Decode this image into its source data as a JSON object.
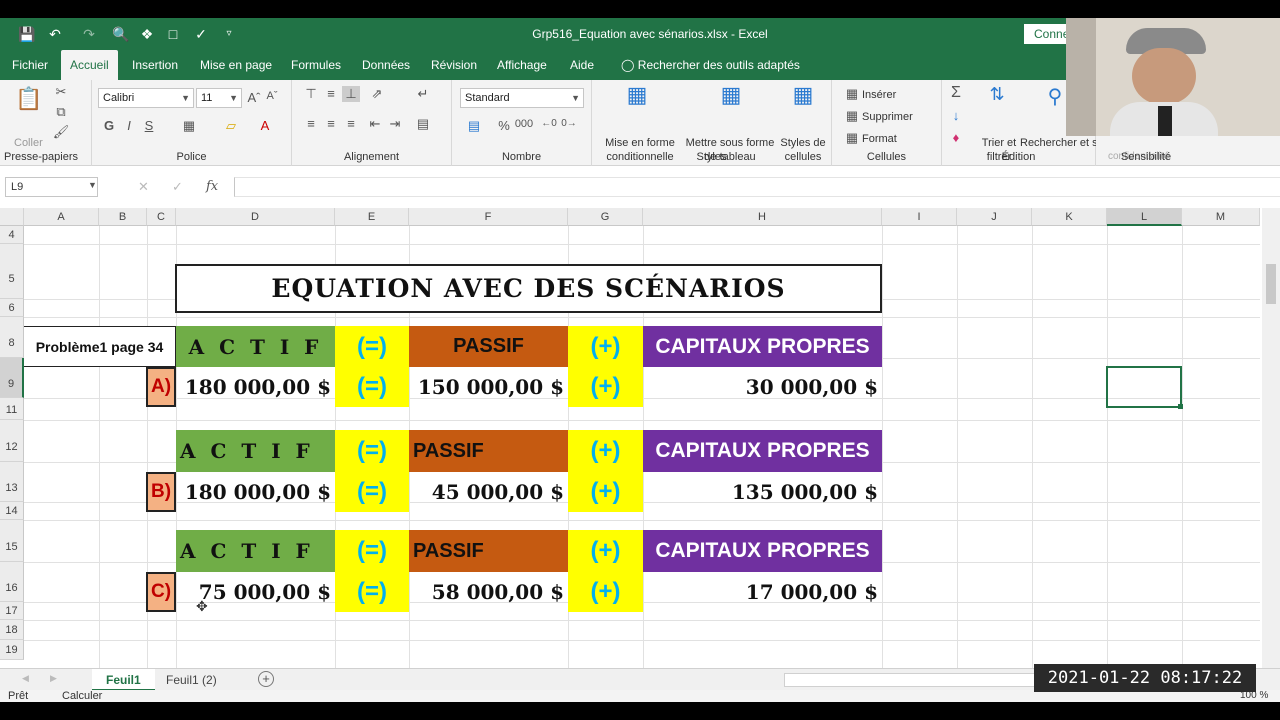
{
  "window": {
    "title": "Grp516_Equation avec sénarios.xlsx  -  Excel",
    "connect": "Conne"
  },
  "tabs": [
    "Fichier",
    "Accueil",
    "Insertion",
    "Mise en page",
    "Formules",
    "Données",
    "Révision",
    "Affichage",
    "Aide",
    "Rechercher des outils adaptés"
  ],
  "ribbon": {
    "clipboard": {
      "paste": "Coller",
      "label": "Presse-papiers"
    },
    "font": {
      "name": "Calibri",
      "size": "11",
      "label": "Police",
      "bold": "G",
      "italic": "I",
      "underline": "S"
    },
    "alignment": {
      "label": "Alignement"
    },
    "number": {
      "format": "Standard",
      "label": "Nombre"
    },
    "styles": {
      "conditional": "Mise en forme conditionnelle",
      "table": "Mettre sous forme de tableau",
      "cell": "Styles de cellules",
      "label": "Styles"
    },
    "cells": {
      "insert": "Insérer",
      "delete": "Supprimer",
      "format": "Format",
      "label": "Cellules"
    },
    "editing": {
      "sort": "Trier et filtrer",
      "find": "Rechercher et sélectionner",
      "label": "Édition"
    },
    "sensitivity": {
      "label": "Sensibilité",
      "text": "confidentialité"
    }
  },
  "formula_bar": {
    "name_box": "L9",
    "fx": "fx",
    "content": ""
  },
  "columns": [
    "A",
    "B",
    "C",
    "D",
    "E",
    "F",
    "G",
    "H",
    "I",
    "J",
    "K",
    "L",
    "M"
  ],
  "rows": [
    "4",
    "5",
    "6",
    "8",
    "9",
    "11",
    "12",
    "13",
    "14",
    "15",
    "16",
    "17",
    "18",
    "19"
  ],
  "sheet": {
    "title": "EQUATION AVEC DES SCÉNARIOS",
    "problem": "Problème1 page 34",
    "actif": "A C T I F",
    "passif": "PASSIF",
    "capitaux": "CAPITAUX PROPRES",
    "eq": "(=)",
    "plus": "(+)",
    "scenarios": [
      {
        "label": "A)",
        "actif": "180 000,00 $",
        "passif": "150 000,00 $",
        "capitaux": "30 000,00 $"
      },
      {
        "label": "B)",
        "actif": "180 000,00 $",
        "passif": "45 000,00 $",
        "capitaux": "135 000,00 $"
      },
      {
        "label": "C)",
        "actif": "75 000,00 $",
        "passif": "58 000,00 $",
        "capitaux": "17 000,00 $"
      }
    ]
  },
  "sheet_tabs": [
    "Feuil1",
    "Feuil1 (2)"
  ],
  "status": {
    "ready": "Prêt",
    "calc": "Calculer",
    "zoom": "100 %"
  },
  "timestamp": "2021-01-22  08:17:22",
  "colors": {
    "excel_green": "#217346",
    "actif": "#70ad47",
    "passif": "#c55a11",
    "capitaux": "#7030a0",
    "operator": "#ffff00"
  }
}
